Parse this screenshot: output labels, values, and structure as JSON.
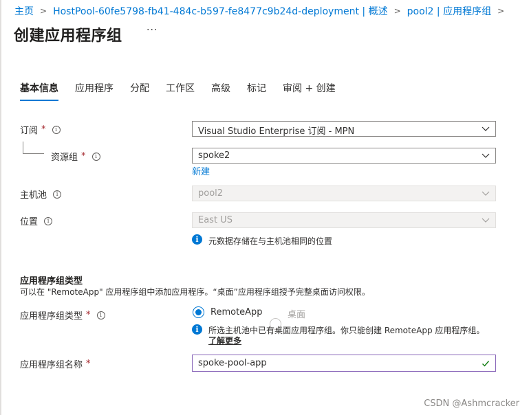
{
  "breadcrumb": {
    "home": "主页",
    "deployment": "HostPool-60fe5798-fb41-484c-b597-fe8477c9b24d-deployment | 概述",
    "pool": "pool2 | 应用程序组"
  },
  "page_title": "创建应用程序组",
  "more_label": "···",
  "tabs": [
    "基本信息",
    "应用程序",
    "分配",
    "工作区",
    "高级",
    "标记",
    "审阅 + 创建"
  ],
  "active_tab": "基本信息",
  "form": {
    "subscription": {
      "label": "订阅",
      "required": "*",
      "value": "Visual Studio Enterprise 订阅 - MPN"
    },
    "resource_group": {
      "label": "资源组",
      "required": "*",
      "value": "spoke2",
      "new_link": "新建"
    },
    "host_pool": {
      "label": "主机池",
      "value": "pool2"
    },
    "location": {
      "label": "位置",
      "value": "East US",
      "note": "元数据存储在与主机池相同的位置"
    }
  },
  "app_group_type_section": {
    "title": "应用程序组类型",
    "description": "可以在 \"RemoteApp\" 应用程序组中添加应用程序。“桌面”应用程序组授予完整桌面访问权限。",
    "type_label": "应用程序组类型",
    "required": "*",
    "options": [
      "RemoteApp",
      "桌面"
    ],
    "selected": "RemoteApp",
    "note": "所选主机池中已有桌面应用程序组。你只能创建 RemoteApp 应用程序组。",
    "learn_more": "了解更多",
    "name_label": "应用程序组名称",
    "name_value": "spoke-pool-app"
  },
  "info_glyph": "i",
  "watermark": "CSDN @Ashmcracker",
  "colors": {
    "accent": "#0078d4",
    "required": "#a4262c",
    "valid_check": "#107c10",
    "focus_border": "#8764b8"
  }
}
